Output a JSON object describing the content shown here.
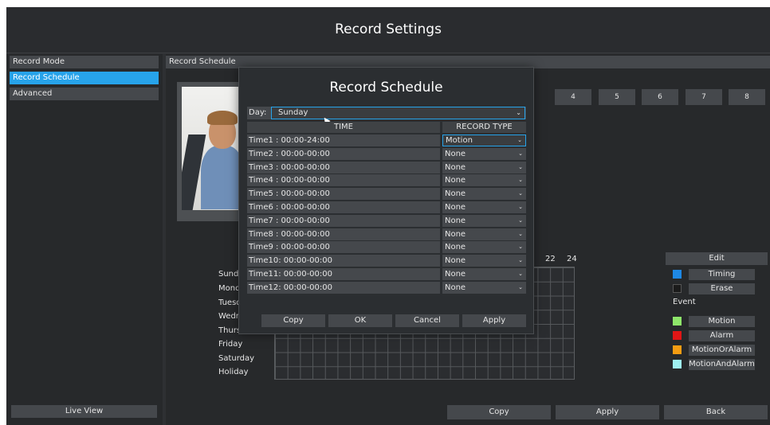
{
  "window": {
    "title": "Record Settings"
  },
  "sidebar": {
    "items": [
      {
        "label": "Record Mode"
      },
      {
        "label": "Record Schedule"
      },
      {
        "label": "Advanced"
      }
    ],
    "live_view_label": "Live View"
  },
  "main": {
    "section_label": "Record Schedule",
    "channels": [
      "4",
      "5",
      "6",
      "7",
      "8"
    ],
    "grid_hours": [
      "22",
      "24"
    ],
    "days": [
      "Sunda",
      "Monda",
      "Tuesda",
      "Wedne",
      "Thursc",
      "Friday",
      "Saturday",
      "Holiday"
    ],
    "edit_label": "Edit",
    "legend": {
      "timing": "Timing",
      "erase": "Erase",
      "event_label": "Event",
      "motion": "Motion",
      "alarm": "Alarm",
      "motion_or_alarm": "MotionOrAlarm",
      "motion_and_alarm": "MotionAndAlarm"
    },
    "colors": {
      "timing": "#1e88e5",
      "erase": "#1b1b1b",
      "motion": "#8ee66a",
      "alarm": "#e01616",
      "motion_or_alarm": "#f39c12",
      "motion_and_alarm": "#9ff0f0",
      "accent": "#27a3ea"
    }
  },
  "footer": {
    "copy_label": "Copy",
    "apply_label": "Apply",
    "back_label": "Back"
  },
  "dialog": {
    "title": "Record Schedule",
    "day_label": "Day:",
    "day_value": "Sunday",
    "col_time": "TIME",
    "col_type": "RECORD TYPE",
    "rows": [
      {
        "time": "Time1  : 00:00-24:00",
        "type": "Motion"
      },
      {
        "time": "Time2  : 00:00-00:00",
        "type": "None"
      },
      {
        "time": "Time3  : 00:00-00:00",
        "type": "None"
      },
      {
        "time": "Time4  : 00:00-00:00",
        "type": "None"
      },
      {
        "time": "Time5  : 00:00-00:00",
        "type": "None"
      },
      {
        "time": "Time6  : 00:00-00:00",
        "type": "None"
      },
      {
        "time": "Time7  : 00:00-00:00",
        "type": "None"
      },
      {
        "time": "Time8  : 00:00-00:00",
        "type": "None"
      },
      {
        "time": "Time9  : 00:00-00:00",
        "type": "None"
      },
      {
        "time": "Time10: 00:00-00:00",
        "type": "None"
      },
      {
        "time": "Time11: 00:00-00:00",
        "type": "None"
      },
      {
        "time": "Time12: 00:00-00:00",
        "type": "None"
      }
    ],
    "buttons": {
      "copy": "Copy",
      "ok": "OK",
      "cancel": "Cancel",
      "apply": "Apply"
    }
  }
}
